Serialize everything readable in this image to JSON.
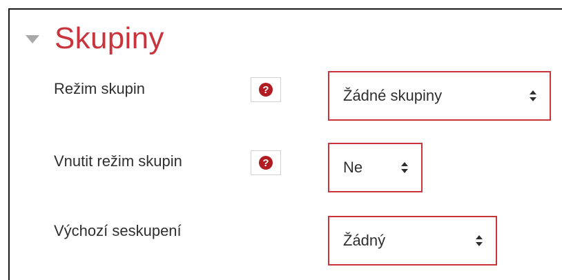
{
  "section": {
    "title": "Skupiny",
    "toggle_icon": "triangle-down-icon"
  },
  "fields": [
    {
      "label": "Režim skupin",
      "help_icon": "question-circle-icon",
      "value": "Žádné skupiny"
    },
    {
      "label": "Vnutit režim skupin",
      "help_icon": "question-circle-icon",
      "value": "Ne"
    },
    {
      "label": "Výchozí seskupení",
      "value": "Žádný"
    }
  ],
  "colors": {
    "accent": "#c9333b",
    "text": "#2f2f2f"
  }
}
